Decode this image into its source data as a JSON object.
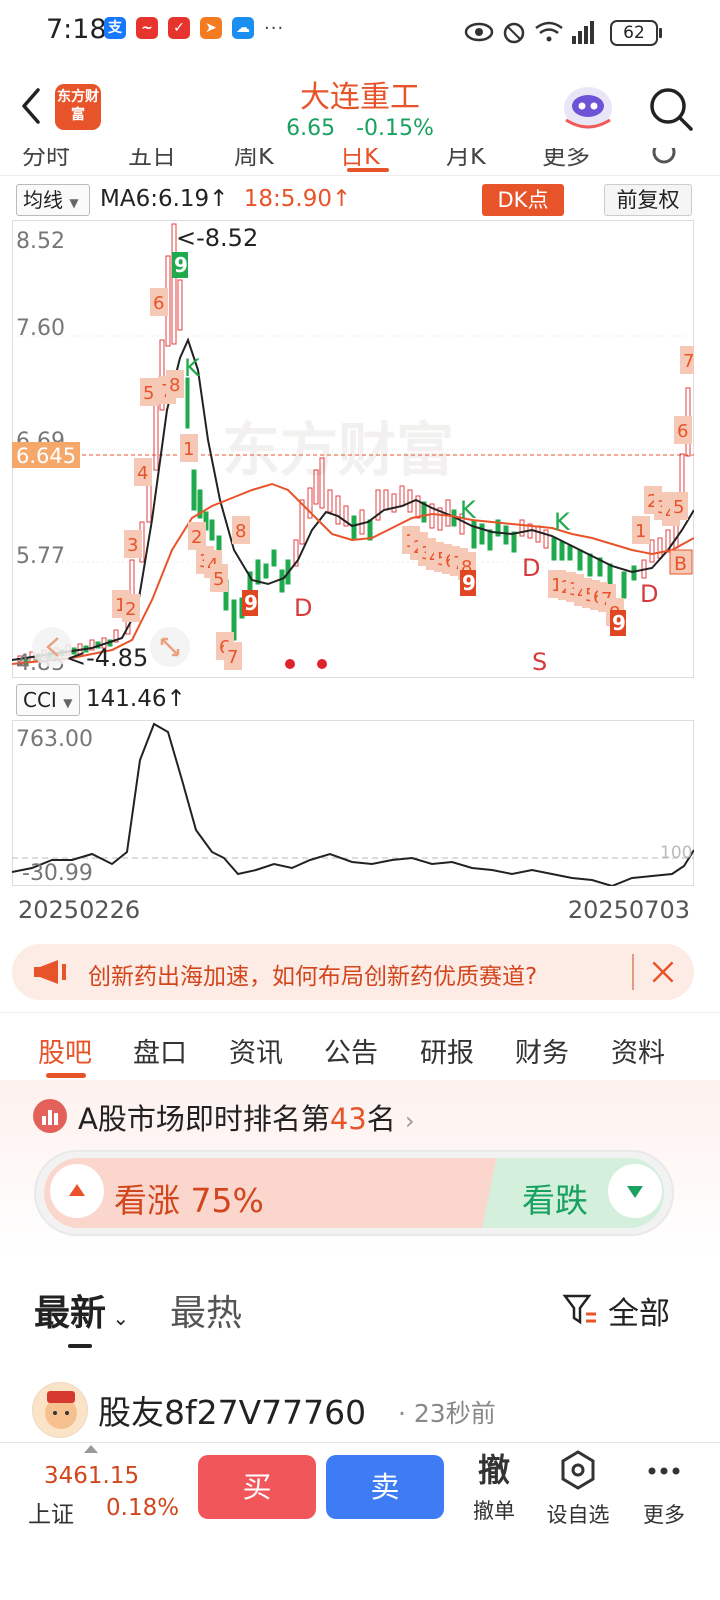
{
  "status_bar": {
    "time": "7:18",
    "battery": "62",
    "app_icons": [
      {
        "name": "alipay",
        "glyph": "支",
        "color": "#1677ff"
      },
      {
        "name": "app2",
        "glyph": "~",
        "color": "#e8342e"
      },
      {
        "name": "app3",
        "glyph": "✓",
        "color": "#e8342e"
      },
      {
        "name": "app4",
        "glyph": "➤",
        "color": "#f47b20"
      },
      {
        "name": "app5",
        "glyph": "☁",
        "color": "#1b8ef2"
      }
    ],
    "more": "···"
  },
  "header": {
    "logo": "东方财富",
    "stock_name": "大连重工",
    "price": "6.65",
    "change": "-0.15%"
  },
  "period_tabs": [
    "分时",
    "五日",
    "周K",
    "日K",
    "月K",
    "更多"
  ],
  "indicator": {
    "selector": "均线",
    "ma6": "MA6:6.19↑",
    "ma18": "18:5.90↑",
    "dk": "DK点",
    "adjust": "前复权"
  },
  "main_chart": {
    "y_labels": [
      "8.52",
      "7.60",
      "6.69",
      "5.77",
      "4.85"
    ],
    "current_price_tag": "6.645",
    "high_annot": "<-8.52",
    "low_annot": "<-4.85",
    "signals_k": [
      "K",
      "K",
      "K"
    ],
    "signals_d": [
      "D",
      "D",
      "D"
    ],
    "signal_s": "S",
    "signal_b": "B",
    "seq_9": [
      "9",
      "9",
      "9",
      "9"
    ],
    "watermark": "东方财富"
  },
  "cci": {
    "selector": "CCI",
    "value": "141.46↑",
    "top_label": "763.00",
    "bottom_label": "-30.99",
    "ref_label": "100"
  },
  "dates": {
    "start": "20250226",
    "end": "20250703"
  },
  "news_banner": {
    "text": "创新药出海加速，如何布局创新药优质赛道?"
  },
  "content_tabs": [
    "股吧",
    "盘口",
    "资讯",
    "公告",
    "研报",
    "财务",
    "资料"
  ],
  "rank": {
    "prefix": "A股市场即时排名第",
    "number": "43",
    "suffix": "名"
  },
  "vote": {
    "up": "看涨 75%",
    "down": "看跌"
  },
  "sort": {
    "latest": "最新",
    "hot": "最热",
    "filter": "全部"
  },
  "post": {
    "user": "股友8f27V77760",
    "time": "· 23秒前"
  },
  "bottom_bar": {
    "index_value": "3461.15",
    "index_name": "上证",
    "index_pct": "0.18%",
    "buy": "买",
    "sell": "卖",
    "cancel_icon": "撤",
    "cancel_label": "撤单",
    "watch_label": "设自选",
    "more_label": "更多"
  }
}
